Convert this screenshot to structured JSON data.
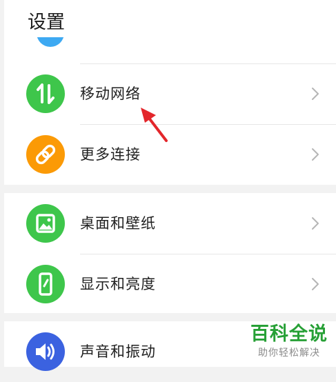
{
  "page": {
    "title": "设置"
  },
  "colors": {
    "green": "#3ec64b",
    "orange": "#fb9a06",
    "blue": "#3b62e0",
    "partial_blue": "#3da9f2",
    "annotation_red": "#e3262b",
    "watermark_green": "#27a036"
  },
  "groups": [
    {
      "items": [
        {
          "label": "移动网络",
          "icon": "mobile-data-arrows-icon"
        },
        {
          "label": "更多连接",
          "icon": "link-chain-icon"
        }
      ]
    },
    {
      "items": [
        {
          "label": "桌面和壁纸",
          "icon": "wallpaper-image-icon"
        },
        {
          "label": "显示和亮度",
          "icon": "display-phone-icon"
        }
      ]
    },
    {
      "items": [
        {
          "label": "声音和振动",
          "icon": "speaker-volume-icon"
        }
      ]
    }
  ],
  "annotation": {
    "icon": "red-arrow-icon"
  },
  "watermark": {
    "title": "百科全说",
    "subtitle": "助你轻松解决"
  }
}
